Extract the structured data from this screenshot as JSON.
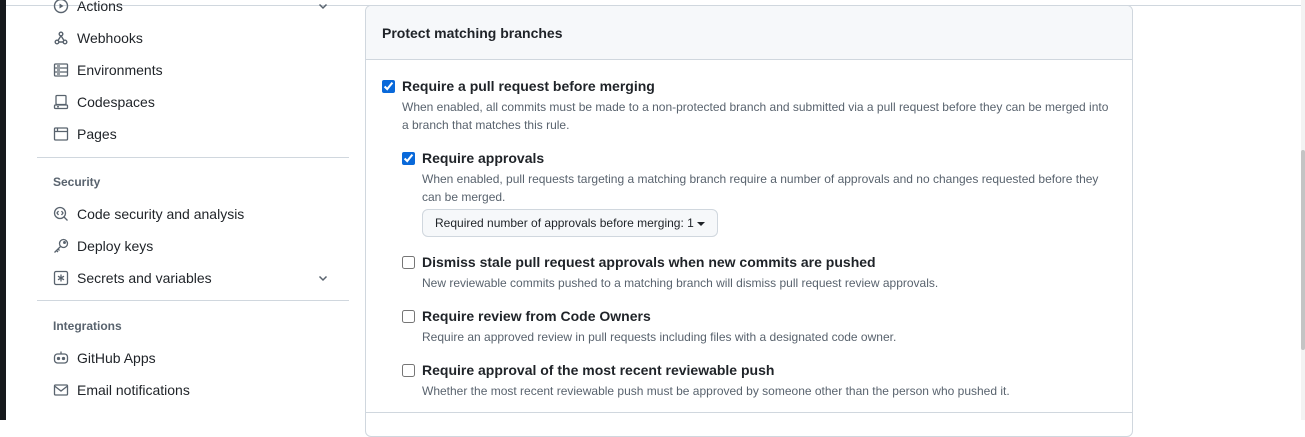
{
  "sidebar": {
    "items_top": [
      {
        "label": "Actions",
        "icon": "play-circle-icon",
        "has_chevron": true
      },
      {
        "label": "Webhooks",
        "icon": "webhook-icon"
      },
      {
        "label": "Environments",
        "icon": "server-icon"
      },
      {
        "label": "Codespaces",
        "icon": "codespaces-icon"
      },
      {
        "label": "Pages",
        "icon": "browser-icon"
      }
    ],
    "security_heading": "Security",
    "security_items": [
      {
        "label": "Code security and analysis",
        "icon": "codescan-icon"
      },
      {
        "label": "Deploy keys",
        "icon": "key-icon"
      },
      {
        "label": "Secrets and variables",
        "icon": "asterisk-box-icon",
        "has_chevron": true
      }
    ],
    "integrations_heading": "Integrations",
    "integrations_items": [
      {
        "label": "GitHub Apps",
        "icon": "apps-icon"
      },
      {
        "label": "Email notifications",
        "icon": "mail-icon"
      }
    ]
  },
  "panel": {
    "title": "Protect matching branches",
    "rules": [
      {
        "title": "Require a pull request before merging",
        "description": "When enabled, all commits must be made to a non-protected branch and submitted via a pull request before they can be merged into a branch that matches this rule.",
        "checked": true
      },
      {
        "title": "Require approvals",
        "description": "When enabled, pull requests targeting a matching branch require a number of approvals and no changes requested before they can be merged.",
        "checked": true
      },
      {
        "title": "Dismiss stale pull request approvals when new commits are pushed",
        "description": "New reviewable commits pushed to a matching branch will dismiss pull request review approvals.",
        "checked": false
      },
      {
        "title": "Require review from Code Owners",
        "description": "Require an approved review in pull requests including files with a designated code owner.",
        "checked": false
      },
      {
        "title": "Require approval of the most recent reviewable push",
        "description": "Whether the most recent reviewable push must be approved by someone other than the person who pushed it.",
        "checked": false
      }
    ],
    "approvals_select_label": "Required number of approvals before merging: 1"
  },
  "colors": {
    "accent": "#0969da",
    "text": "#1f2328",
    "muted": "#59636e",
    "border": "#d0d7de"
  }
}
